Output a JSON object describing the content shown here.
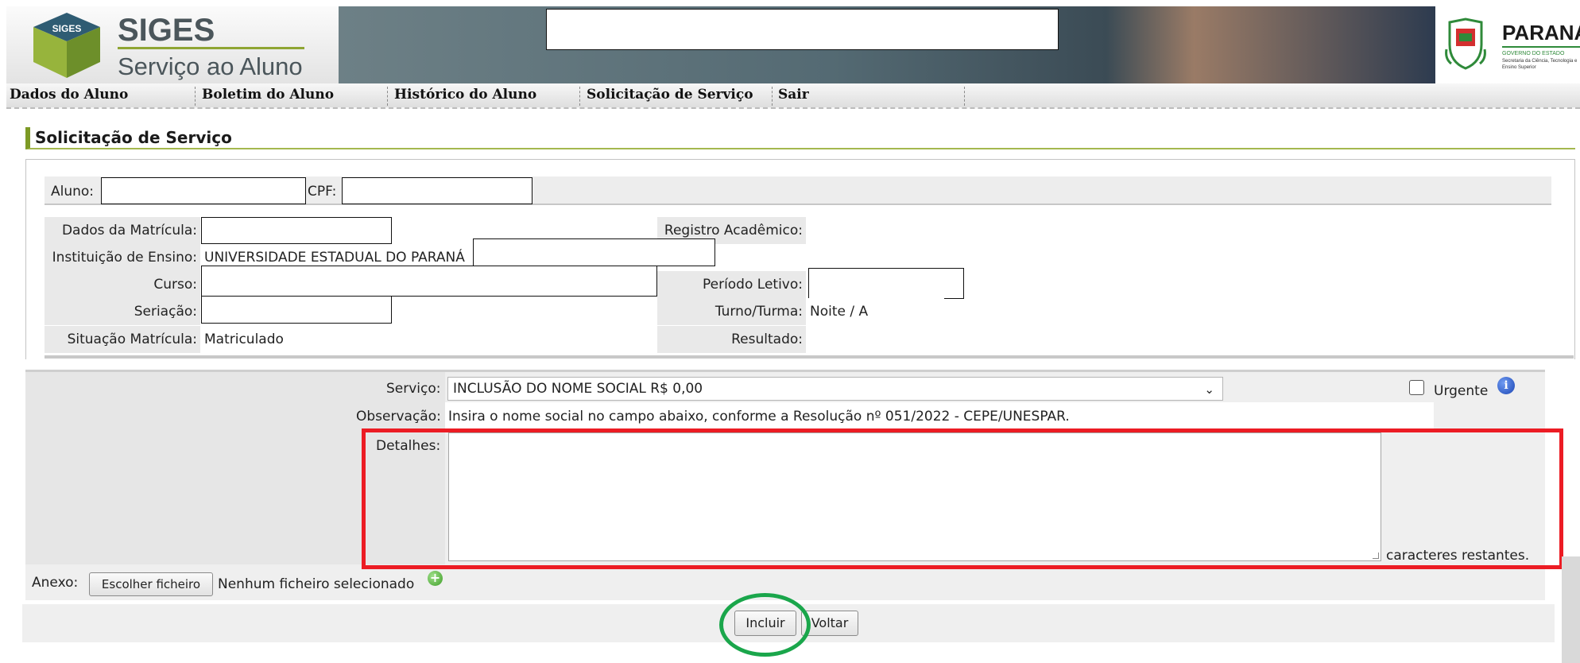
{
  "header": {
    "brand_title": "SIGES",
    "brand_subtitle": "Serviço ao Aluno",
    "cube_label": "SIGES",
    "state_name": "PARANÁ",
    "state_sub": "GOVERNO DO ESTADO",
    "state_sub2": "Secretaria da Ciência, Tecnologia e Ensino Superior",
    "search_value": ""
  },
  "nav": {
    "items": [
      "Dados do Aluno",
      "Boletim do Aluno",
      "Histórico do Aluno",
      "Solicitação de Serviço",
      "Sair"
    ]
  },
  "page": {
    "title": "Solicitação de Serviço"
  },
  "student": {
    "aluno_label": "Aluno:",
    "cpf_label": "CPF:",
    "dados_matricula_label": "Dados da Matrícula:",
    "registro_label": "Registro Acadêmico:",
    "instituicao_label": "Instituição de Ensino:",
    "instituicao_value": "UNIVERSIDADE ESTADUAL DO PARANÁ",
    "curso_label": "Curso:",
    "periodo_label": "Período Letivo:",
    "seriacao_label": "Seriação:",
    "turno_label": "Turno/Turma:",
    "turno_value": "Noite / A",
    "situacao_label": "Situação Matrícula:",
    "situacao_value": "Matriculado",
    "resultado_label": "Resultado:"
  },
  "form": {
    "servico_label": "Serviço:",
    "servico_value": "INCLUSÃO DO NOME SOCIAL R$ 0,00",
    "urgente_label": "Urgente",
    "observacao_label": "Observação:",
    "observacao_value": "Insira o nome social no campo abaixo, conforme a Resolução nº 051/2022 - CEPE/UNESPAR.",
    "detalhes_label": "Detalhes:",
    "caracteres_label": "caracteres restantes.",
    "anexo_label": "Anexo:",
    "choose_file_label": "Escolher ficheiro",
    "no_file_label": "Nenhum ficheiro selecionado"
  },
  "actions": {
    "incluir_label": "Incluir",
    "voltar_label": "Voltar"
  },
  "colors": {
    "accent_green": "#7d9a25",
    "highlight_red": "#ec1c24",
    "highlight_green": "#1aa64b"
  }
}
